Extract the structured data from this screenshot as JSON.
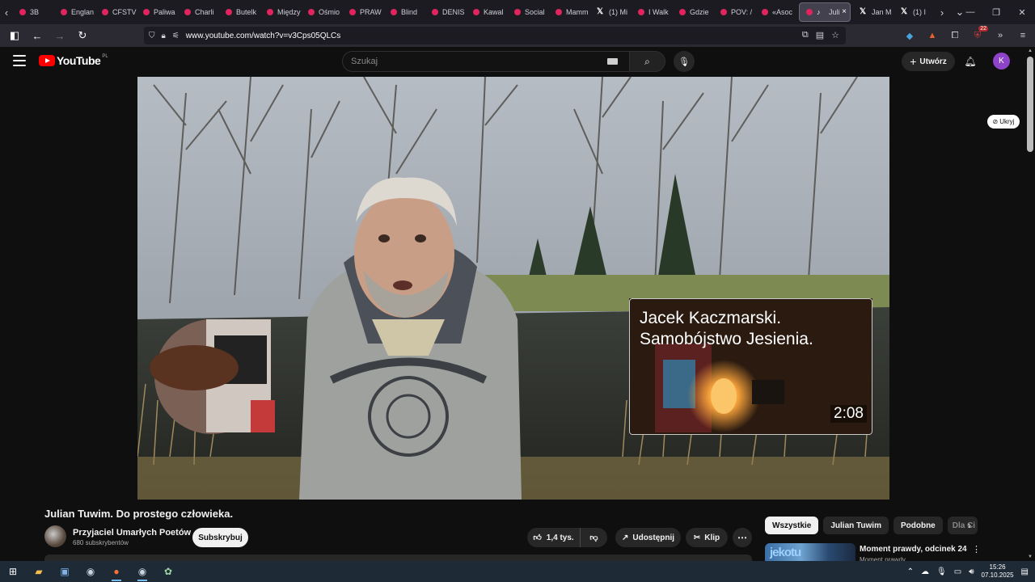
{
  "browser": {
    "tabs": [
      {
        "label": "3B",
        "icon": "youtube"
      },
      {
        "label": "Englan",
        "icon": "youtube"
      },
      {
        "label": "CFSTV",
        "icon": "youtube"
      },
      {
        "label": "Paliwa",
        "icon": "youtube"
      },
      {
        "label": "Charli",
        "icon": "youtube"
      },
      {
        "label": "Butelk",
        "icon": "youtube"
      },
      {
        "label": "Między",
        "icon": "youtube"
      },
      {
        "label": "Ośmio",
        "icon": "youtube"
      },
      {
        "label": "PRAW",
        "icon": "youtube"
      },
      {
        "label": "Blind",
        "icon": "youtube"
      },
      {
        "label": "DENIS",
        "icon": "youtube"
      },
      {
        "label": "Kawal",
        "icon": "youtube"
      },
      {
        "label": "Social",
        "icon": "youtube"
      },
      {
        "label": "Mamm",
        "icon": "youtube"
      },
      {
        "label": "(1) Mi",
        "icon": "x"
      },
      {
        "label": "I Walk",
        "icon": "youtube"
      },
      {
        "label": "Gdzie",
        "icon": "youtube"
      },
      {
        "label": "POV: /",
        "icon": "youtube"
      },
      {
        "label": "«Asoc",
        "icon": "youtube"
      }
    ],
    "active_tab": {
      "label": "Juli",
      "close": "×"
    },
    "tabs_after": [
      {
        "label": "Jan M",
        "icon": "x"
      },
      {
        "label": "(1) I",
        "icon": "x"
      }
    ],
    "url": "www.youtube.com/watch?v=v3Cps05QLCs",
    "extension_badge": "22"
  },
  "youtube": {
    "logo_text": "YouTube",
    "country_code": "PL",
    "search_placeholder": "Szukaj",
    "create_label": "Utwórz",
    "avatar_letter": "K",
    "hide_label": "Ukryj"
  },
  "player": {
    "end_card": {
      "title_line1": "Jacek Kaczmarski.",
      "title_line2": "Samobójstwo Jesienia.",
      "duration": "2:08"
    }
  },
  "video": {
    "title": "Julian Tuwim. Do prostego człowieka.",
    "channel_name": "Przyjaciel Umarłych Poetów",
    "subscribers": "680 subskrybentów",
    "subscribe_label": "Subskrybuj",
    "likes": "1,4 tys.",
    "share_label": "Udostępnij",
    "clip_label": "Klip"
  },
  "sidebar": {
    "chips": [
      "Wszystkie",
      "Julian Tuwim",
      "Podobne",
      "Dla Ci"
    ],
    "recommendation": {
      "title": "Moment prawdy, odcinek 24",
      "channel": "Moment prawdy",
      "thumb_text": "jekotu"
    }
  },
  "taskbar": {
    "time": "15:26",
    "date": "07.10.2025"
  },
  "colors": {
    "youtube_red": "#ff0000",
    "avatar_purple": "#8e44c9",
    "background": "#0f0f0f"
  }
}
